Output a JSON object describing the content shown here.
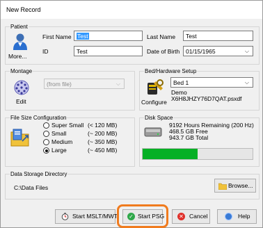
{
  "window": {
    "title": "New Record"
  },
  "patient": {
    "group_label": "Patient",
    "more_label": "More...",
    "first_name_label": "First Name",
    "first_name_value": "Test",
    "id_label": "ID",
    "id_value": "Test",
    "last_name_label": "Last Name",
    "last_name_value": "Test",
    "dob_label": "Date of Birth",
    "dob_value": "01/15/1965"
  },
  "montage": {
    "group_label": "Montage",
    "edit_label": "Edit",
    "selected": "(from file)"
  },
  "bed": {
    "group_label": "Bed/Hardware Setup",
    "configure_label": "Configure",
    "selected": "Bed 1",
    "line1": "Demo",
    "line2": "X6H8JHZY76D7QAT.psxdf"
  },
  "file_size": {
    "group_label": "File Size Configuration",
    "options": [
      {
        "label": "Super Small",
        "size": "(< 120 MB)",
        "selected": false
      },
      {
        "label": "Small",
        "size": "(~ 200 MB)",
        "selected": false
      },
      {
        "label": "Medium",
        "size": "(~ 350 MB)",
        "selected": false
      },
      {
        "label": "Large",
        "size": "(~ 450 MB)",
        "selected": true
      }
    ]
  },
  "disk": {
    "group_label": "Disk Space",
    "line1": "9192 Hours Remaining (200 Hz)",
    "line2": "468.5 GB Free",
    "line3": "943.7 GB Total",
    "used_fraction": 0.5,
    "bar_color": "#06b025"
  },
  "storage": {
    "group_label": "Data Storage Directory",
    "path": "C:\\Data Files",
    "browse_label": "Browse..."
  },
  "buttons": {
    "start_mslt": "Start MSLT/MWT",
    "start_psg": "Start PSG",
    "cancel": "Cancel",
    "help": "Help"
  },
  "colors": {
    "highlight": "#f07b1e",
    "selection": "#3399ff"
  }
}
